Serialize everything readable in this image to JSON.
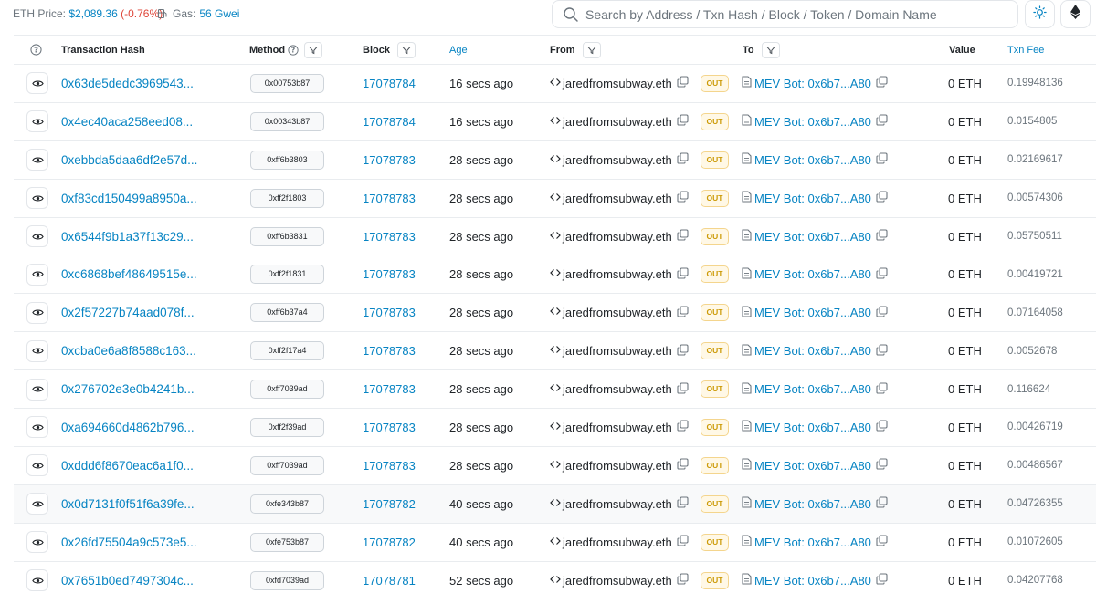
{
  "header": {
    "eth_price_label": "ETH Price:",
    "eth_price_value": "$2,089.36",
    "eth_price_change": "(-0.76%)",
    "gas_label": "Gas:",
    "gas_value": "56 Gwei",
    "search_placeholder": "Search by Address / Txn Hash / Block / Token / Domain Name",
    "theme_icon": "sun-icon",
    "network_icon": "ethereum-icon"
  },
  "colors": {
    "link": "#0784c3",
    "negative": "#de4437",
    "out_badge": "#cc9a06"
  },
  "table": {
    "columns": {
      "hash": "Transaction Hash",
      "method": "Method",
      "block": "Block",
      "age": "Age",
      "from": "From",
      "to": "To",
      "value": "Value",
      "fee": "Txn Fee"
    },
    "rows": [
      {
        "hash": "0x63de5dedc3969543...",
        "method": "0x00753b87",
        "block": "17078784",
        "age": "16 secs ago",
        "from": "jaredfromsubway.eth",
        "direction": "OUT",
        "to": "MEV Bot: 0x6b7...A80",
        "value": "0 ETH",
        "fee": "0.19948136"
      },
      {
        "hash": "0x4ec40aca258eed08...",
        "method": "0x00343b87",
        "block": "17078784",
        "age": "16 secs ago",
        "from": "jaredfromsubway.eth",
        "direction": "OUT",
        "to": "MEV Bot: 0x6b7...A80",
        "value": "0 ETH",
        "fee": "0.0154805"
      },
      {
        "hash": "0xebbda5daa6df2e57d...",
        "method": "0xff6b3803",
        "block": "17078783",
        "age": "28 secs ago",
        "from": "jaredfromsubway.eth",
        "direction": "OUT",
        "to": "MEV Bot: 0x6b7...A80",
        "value": "0 ETH",
        "fee": "0.02169617"
      },
      {
        "hash": "0xf83cd150499a8950a...",
        "method": "0xff2f1803",
        "block": "17078783",
        "age": "28 secs ago",
        "from": "jaredfromsubway.eth",
        "direction": "OUT",
        "to": "MEV Bot: 0x6b7...A80",
        "value": "0 ETH",
        "fee": "0.00574306"
      },
      {
        "hash": "0x6544f9b1a37f13c29...",
        "method": "0xff6b3831",
        "block": "17078783",
        "age": "28 secs ago",
        "from": "jaredfromsubway.eth",
        "direction": "OUT",
        "to": "MEV Bot: 0x6b7...A80",
        "value": "0 ETH",
        "fee": "0.05750511"
      },
      {
        "hash": "0xc6868bef48649515e...",
        "method": "0xff2f1831",
        "block": "17078783",
        "age": "28 secs ago",
        "from": "jaredfromsubway.eth",
        "direction": "OUT",
        "to": "MEV Bot: 0x6b7...A80",
        "value": "0 ETH",
        "fee": "0.00419721"
      },
      {
        "hash": "0x2f57227b74aad078f...",
        "method": "0xff6b37a4",
        "block": "17078783",
        "age": "28 secs ago",
        "from": "jaredfromsubway.eth",
        "direction": "OUT",
        "to": "MEV Bot: 0x6b7...A80",
        "value": "0 ETH",
        "fee": "0.07164058"
      },
      {
        "hash": "0xcba0e6a8f8588c163...",
        "method": "0xff2f17a4",
        "block": "17078783",
        "age": "28 secs ago",
        "from": "jaredfromsubway.eth",
        "direction": "OUT",
        "to": "MEV Bot: 0x6b7...A80",
        "value": "0 ETH",
        "fee": "0.0052678"
      },
      {
        "hash": "0x276702e3e0b4241b...",
        "method": "0xff7039ad",
        "block": "17078783",
        "age": "28 secs ago",
        "from": "jaredfromsubway.eth",
        "direction": "OUT",
        "to": "MEV Bot: 0x6b7...A80",
        "value": "0 ETH",
        "fee": "0.116624"
      },
      {
        "hash": "0xa694660d4862b796...",
        "method": "0xff2f39ad",
        "block": "17078783",
        "age": "28 secs ago",
        "from": "jaredfromsubway.eth",
        "direction": "OUT",
        "to": "MEV Bot: 0x6b7...A80",
        "value": "0 ETH",
        "fee": "0.00426719"
      },
      {
        "hash": "0xddd6f8670eac6a1f0...",
        "method": "0xff7039ad",
        "block": "17078783",
        "age": "28 secs ago",
        "from": "jaredfromsubway.eth",
        "direction": "OUT",
        "to": "MEV Bot: 0x6b7...A80",
        "value": "0 ETH",
        "fee": "0.00486567"
      },
      {
        "hash": "0x0d7131f0f51f6a39fe...",
        "method": "0xfe343b87",
        "block": "17078782",
        "age": "40 secs ago",
        "from": "jaredfromsubway.eth",
        "direction": "OUT",
        "to": "MEV Bot: 0x6b7...A80",
        "value": "0 ETH",
        "fee": "0.04726355"
      },
      {
        "hash": "0x26fd75504a9c573e5...",
        "method": "0xfe753b87",
        "block": "17078782",
        "age": "40 secs ago",
        "from": "jaredfromsubway.eth",
        "direction": "OUT",
        "to": "MEV Bot: 0x6b7...A80",
        "value": "0 ETH",
        "fee": "0.01072605"
      },
      {
        "hash": "0x7651b0ed7497304c...",
        "method": "0xfd7039ad",
        "block": "17078781",
        "age": "52 secs ago",
        "from": "jaredfromsubway.eth",
        "direction": "OUT",
        "to": "MEV Bot: 0x6b7...A80",
        "value": "0 ETH",
        "fee": "0.04207768"
      }
    ]
  }
}
